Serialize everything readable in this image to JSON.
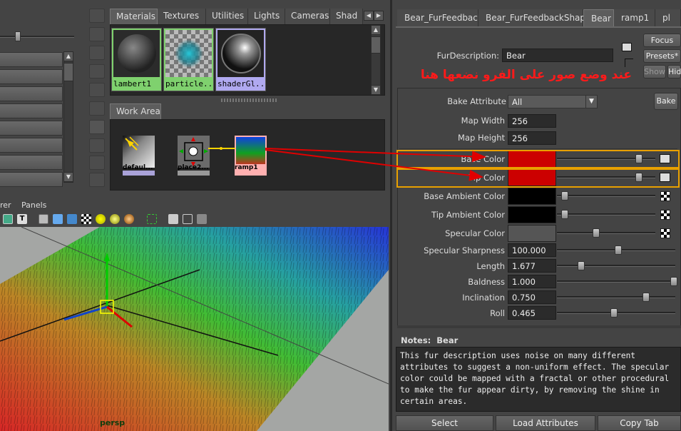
{
  "hypershade": {
    "tabs": [
      "Materials",
      "Textures",
      "Utilities",
      "Lights",
      "Cameras",
      "Shad"
    ],
    "swatches": [
      "lambert1",
      "particle...",
      "shaderGl..."
    ],
    "work_area_tab": "Work Area",
    "nodes": [
      "defaul...",
      "place2...",
      "ramp1"
    ]
  },
  "viewport": {
    "menu": [
      "rer",
      "Panels"
    ],
    "camera_label": "persp"
  },
  "attribute_editor": {
    "tabs": [
      "Bear_FurFeedback",
      "Bear_FurFeedbackShape",
      "Bear",
      "ramp1",
      "pl"
    ],
    "focus_label": "Focus",
    "presets_label": "Presets*",
    "show_label": "Show",
    "hide_label": "Hid",
    "fur_description_label": "FurDescription:",
    "fur_description_value": "Bear",
    "annotation_arabic": "عند وضع صور على الفرو نضعها هنا",
    "bake_attribute_label": "Bake Attribute",
    "bake_attribute_value": "All",
    "bake_button": "Bake",
    "map_width_label": "Map Width",
    "map_width_value": "256",
    "map_height_label": "Map Height",
    "map_height_value": "256",
    "attributes": [
      {
        "label": "Base Color",
        "kind": "color",
        "color": "#cc0000"
      },
      {
        "label": "Tip Color",
        "kind": "color",
        "color": "#cc0000"
      },
      {
        "label": "Base Ambient Color",
        "kind": "color",
        "color": "#000000"
      },
      {
        "label": "Tip Ambient Color",
        "kind": "color",
        "color": "#000000"
      },
      {
        "label": "Specular Color",
        "kind": "color",
        "color": "#555555"
      },
      {
        "label": "Specular Sharpness",
        "kind": "value",
        "value": "100.000"
      },
      {
        "label": "Length",
        "kind": "value",
        "value": "1.677"
      },
      {
        "label": "Baldness",
        "kind": "value",
        "value": "1.000"
      },
      {
        "label": "Inclination",
        "kind": "value",
        "value": "0.750"
      },
      {
        "label": "Roll",
        "kind": "value",
        "value": "0.465"
      }
    ],
    "notes_label": "Notes:  Bear",
    "notes_text": "This fur description uses noise on many different attributes to suggest a non-uniform effect. The specular color could be mapped with a fractal or other procedural to make the fur appear dirty, by removing the shine in certain areas.",
    "bottom_buttons": [
      "Select",
      "Load Attributes",
      "Copy Tab"
    ]
  },
  "colors": {
    "highlight_orange": "#e8a000",
    "arrow_red": "#e00000",
    "arabic_text_red": "#ff1a1a"
  }
}
